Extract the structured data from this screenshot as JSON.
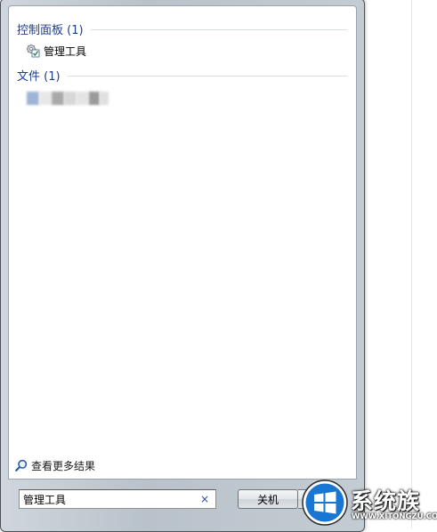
{
  "groups": [
    {
      "header": "控制面板 (1)",
      "items": [
        {
          "label": "管理工具",
          "icon": "admin-tools-icon"
        }
      ]
    },
    {
      "header": "文件 (1)",
      "items": [
        {
          "label": "",
          "icon": "file-icon",
          "blurred": true
        }
      ]
    }
  ],
  "see_more": {
    "label": "查看更多结果",
    "icon": "search-icon"
  },
  "search": {
    "value": "管理工具",
    "clear_label": "×"
  },
  "shutdown": {
    "label": "关机",
    "arrow_icon": "chevron-right-icon"
  },
  "watermark": {
    "title": "系统族",
    "url": "WWW.XITONGZU.COM"
  },
  "colors": {
    "group_header": "#1e3e8a",
    "frame": "#c4ccd3",
    "win_blue": "#1e88e5"
  }
}
